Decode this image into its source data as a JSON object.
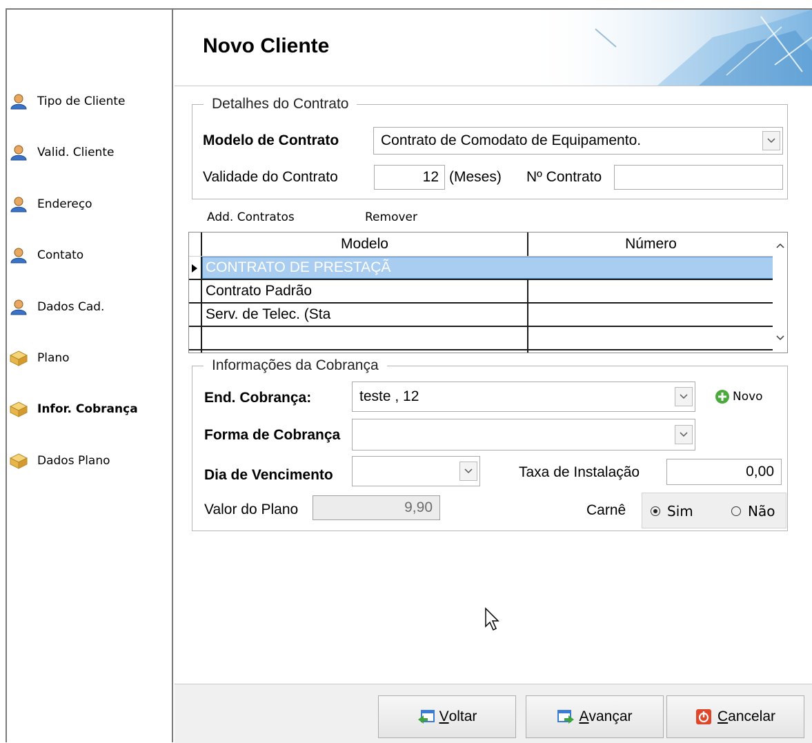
{
  "header": {
    "title": "Novo Cliente"
  },
  "sidebar": {
    "items": [
      {
        "label": "Tipo de Cliente",
        "icon": "user-icon"
      },
      {
        "label": "Valid. Cliente",
        "icon": "user-icon"
      },
      {
        "label": "Endereço",
        "icon": "user-icon"
      },
      {
        "label": "Contato",
        "icon": "user-icon"
      },
      {
        "label": "Dados Cad.",
        "icon": "user-icon"
      },
      {
        "label": "Plano",
        "icon": "package-icon"
      },
      {
        "label": "Infor. Cobrança",
        "icon": "package-icon",
        "active": true
      },
      {
        "label": "Dados Plano",
        "icon": "package-icon"
      }
    ]
  },
  "contract": {
    "legend": "Detalhes do Contrato",
    "model_label": "Modelo de Contrato",
    "model_value": "Contrato de Comodato de Equipamento.",
    "validity_label": "Validade do Contrato",
    "validity_value": "12",
    "validity_unit": "(Meses)",
    "number_label": "Nº Contrato",
    "number_value": ""
  },
  "actions": {
    "add": "Add. Contratos",
    "remove": "Remover"
  },
  "grid": {
    "columns": [
      "Modelo",
      "Número"
    ],
    "rows": [
      {
        "modelo": "CONTRATO DE PRESTAÇÃ",
        "numero": ""
      },
      {
        "modelo": "Contrato Padrão",
        "numero": ""
      },
      {
        "modelo": "Serv. de Telec. (Sta",
        "numero": ""
      },
      {
        "modelo": "",
        "numero": ""
      }
    ]
  },
  "billing": {
    "legend": "Informações da Cobrança",
    "address_label": "End. Cobrança:",
    "address_value": "teste , 12",
    "new_label": "Novo",
    "method_label": "Forma de Cobrança",
    "method_value": "",
    "due_label": "Dia de Vencimento",
    "due_value": "",
    "install_label": "Taxa de Instalação",
    "install_value": "0,00",
    "plan_label": "Valor do Plano",
    "plan_value": "9,90",
    "carne_label": "Carnê",
    "carne_yes": "Sim",
    "carne_no": "Não",
    "carne_selected": "Sim"
  },
  "footer": {
    "back_prefix": "V",
    "back_rest": "oltar",
    "next_prefix": "A",
    "next_rest": "vançar",
    "cancel_prefix": "C",
    "cancel_rest": "ancelar"
  },
  "colors": {
    "selection": "#a8cdf0",
    "header_art": "#3c8fd0"
  }
}
